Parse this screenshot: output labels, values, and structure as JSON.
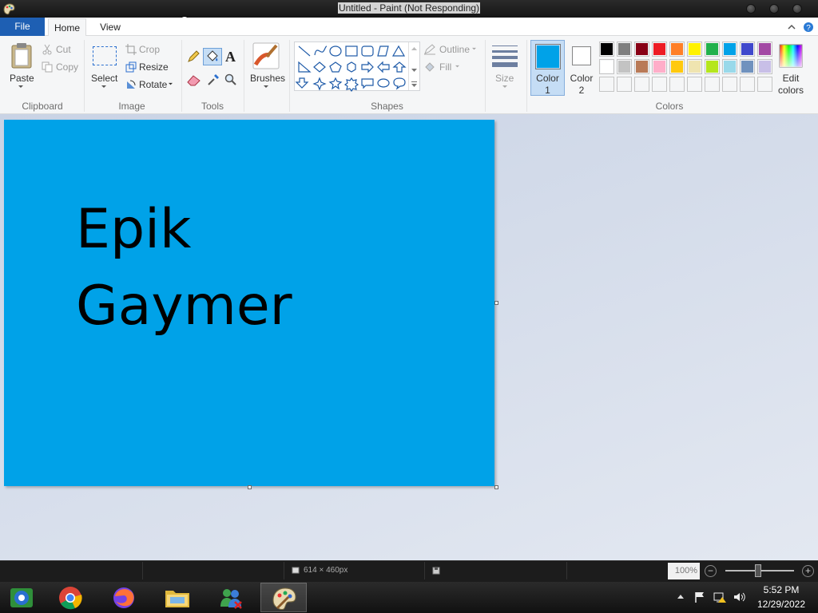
{
  "window": {
    "title": "Untitled - Paint (Not Responding)"
  },
  "tabs": {
    "file": "File",
    "home": "Home",
    "view": "View"
  },
  "clipboard": {
    "paste": "Paste",
    "cut": "Cut",
    "copy": "Copy",
    "group": "Clipboard"
  },
  "image": {
    "select": "Select",
    "crop": "Crop",
    "resize": "Resize",
    "rotate": "Rotate",
    "group": "Image"
  },
  "tools": {
    "group": "Tools"
  },
  "brushes": {
    "label": "Brushes"
  },
  "shapes": {
    "outline": "Outline",
    "fill": "Fill",
    "group": "Shapes"
  },
  "size": {
    "label": "Size"
  },
  "colors": {
    "color1_line1": "Color",
    "color1_line2": "1",
    "color2_line1": "Color",
    "color2_line2": "2",
    "color1_value": "#00a2e8",
    "color2_value": "#ffffff",
    "edit_line1": "Edit",
    "edit_line2": "colors",
    "group": "Colors",
    "palette_row1": [
      "#000000",
      "#7f7f7f",
      "#880015",
      "#ed1c24",
      "#ff7f27",
      "#fff200",
      "#22b14c",
      "#00a2e8",
      "#3f48cc",
      "#a349a4"
    ],
    "palette_row2": [
      "#ffffff",
      "#c3c3c3",
      "#b97a57",
      "#ffaec9",
      "#ffc90e",
      "#efe4b0",
      "#b5e61d",
      "#99d9ea",
      "#7092be",
      "#c8bfe7"
    ],
    "palette_row3": [
      "",
      "",
      "",
      "",
      "",
      "",
      "",
      "",
      "",
      ""
    ]
  },
  "canvas": {
    "line1": "Epik",
    "line2": "Gaymer",
    "background": "#00a2e8"
  },
  "status": {
    "dimensions": "614 × 460px",
    "zoom": "100%",
    "zoom_level_percent": 100
  },
  "taskbar": {
    "time": "5:52 PM",
    "date": "12/29/2022"
  }
}
